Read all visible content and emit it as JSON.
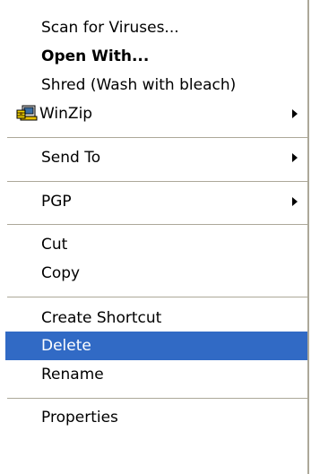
{
  "menu": {
    "items": [
      {
        "label": "Scan for Viruses..."
      },
      {
        "label": "Open With..."
      },
      {
        "label": "Shred (Wash with bleach)"
      },
      {
        "label": "WinZip",
        "icon": "winzip-icon",
        "submenu": true
      },
      {
        "label": "Send To",
        "submenu": true
      },
      {
        "label": "PGP",
        "submenu": true
      },
      {
        "label": "Cut"
      },
      {
        "label": "Copy"
      },
      {
        "label": "Create Shortcut"
      },
      {
        "label": "Delete",
        "selected": true
      },
      {
        "label": "Rename"
      },
      {
        "label": "Properties"
      }
    ],
    "highlight_color": "#316ac5",
    "separator_color": "#aca899"
  }
}
